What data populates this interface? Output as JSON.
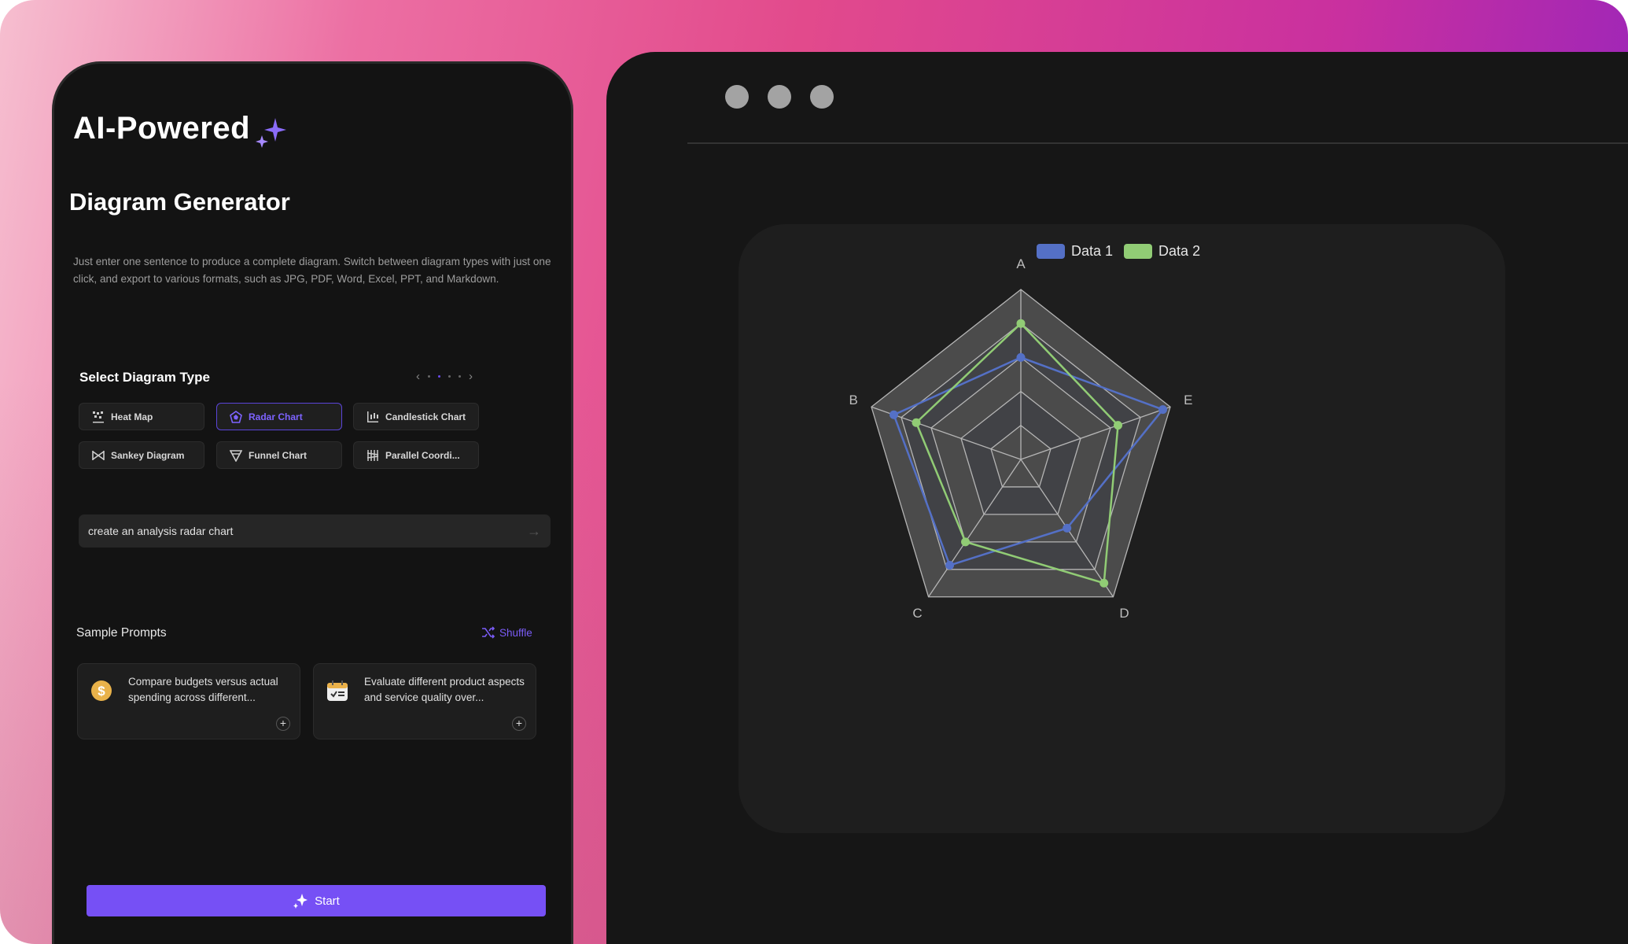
{
  "left_panel": {
    "title": "AI-Powered",
    "subtitle": "Diagram Generator",
    "description": "Just enter one sentence to produce a complete diagram. Switch between diagram types with just one click, and export to various formats, such as JPG, PDF, Word, Excel, PPT, and Markdown.",
    "select_label": "Select Diagram Type",
    "pager": {
      "prev": "‹",
      "next": "›",
      "pages": 4,
      "current": 2
    },
    "diagram_types": [
      {
        "label": "Heat Map",
        "icon": "heatmap-icon",
        "active": false
      },
      {
        "label": "Radar Chart",
        "icon": "radar-icon",
        "active": true
      },
      {
        "label": "Candlestick Chart",
        "icon": "candlestick-icon",
        "active": false
      },
      {
        "label": "Sankey Diagram",
        "icon": "sankey-icon",
        "active": false
      },
      {
        "label": "Funnel Chart",
        "icon": "funnel-icon",
        "active": false
      },
      {
        "label": "Parallel Coordi...",
        "icon": "parallel-icon",
        "active": false
      }
    ],
    "prompt_value": "create an analysis radar chart",
    "sample_prompts_label": "Sample Prompts",
    "shuffle_label": "Shuffle",
    "sample_prompts": [
      {
        "text": "Compare budgets versus actual spending across different...",
        "icon": "dollar-coin-icon"
      },
      {
        "text": "Evaluate different product aspects and service quality over...",
        "icon": "calendar-check-icon"
      }
    ],
    "start_label": "Start",
    "accent": "#7650f5"
  },
  "chart_data": {
    "type": "radar",
    "indicators": [
      "A",
      "B",
      "C",
      "D",
      "E"
    ],
    "max": 100,
    "series": [
      {
        "name": "Data 1",
        "color": "#5470c6",
        "values": [
          60,
          85,
          77,
          50,
          95
        ]
      },
      {
        "name": "Data 2",
        "color": "#91cc75",
        "values": [
          80,
          70,
          60,
          90,
          65
        ]
      }
    ],
    "legend": "top"
  }
}
